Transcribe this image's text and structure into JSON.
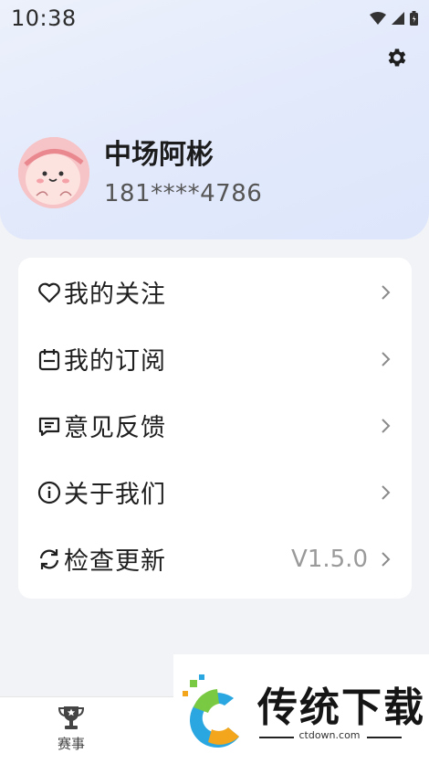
{
  "status_bar": {
    "time": "10:38"
  },
  "profile": {
    "nickname": "中场阿彬",
    "phone": "181****4786"
  },
  "menu": {
    "items": [
      {
        "label": "我的关注",
        "icon": "heart-icon"
      },
      {
        "label": "我的订阅",
        "icon": "calendar-icon"
      },
      {
        "label": "意见反馈",
        "icon": "feedback-icon"
      },
      {
        "label": "关于我们",
        "icon": "info-icon"
      },
      {
        "label": "检查更新",
        "icon": "refresh-icon",
        "value": "V1.5.0"
      }
    ]
  },
  "tabbar": {
    "match_label": "赛事"
  },
  "watermark": {
    "brand": "传统下载",
    "url": "ctdown.com"
  }
}
